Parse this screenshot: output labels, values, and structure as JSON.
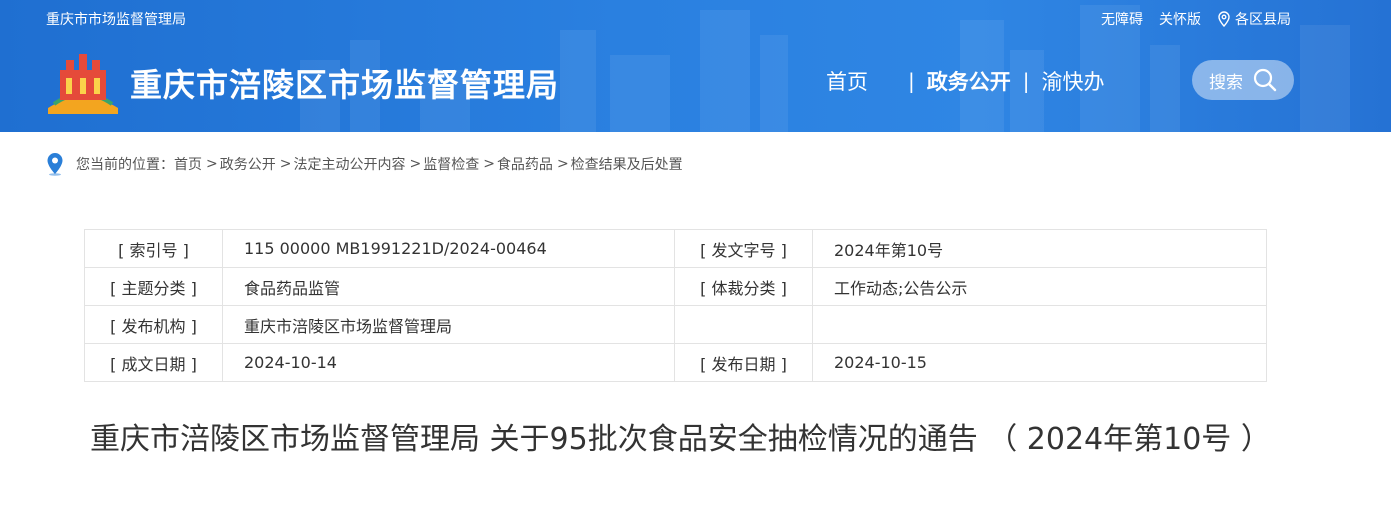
{
  "header": {
    "site_name_small": "重庆市市场监督管理局",
    "title": "重庆市涪陵区市场监督管理局",
    "top_links": {
      "accessibility": "无障碍",
      "care_mode": "关怀版",
      "districts": "各区县局"
    },
    "nav": {
      "home": "首页",
      "separator": "|",
      "gov_affairs": "政务公开",
      "yukuaiban": "渝快办"
    },
    "search_label": "搜索"
  },
  "breadcrumb": {
    "prefix": "您当前的位置：",
    "items": [
      "首页",
      "政务公开",
      "法定主动公开内容",
      "监督检查",
      "食品药品",
      "检查结果及后处置"
    ],
    "arrow": ">"
  },
  "info_table": {
    "rows": [
      {
        "label1": "[ 索引号 ]",
        "value1": "115 00000 MB1991221D/2024-00464",
        "label2": "[ 发文字号 ]",
        "value2": "2024年第10号"
      },
      {
        "label1": "[ 主题分类 ]",
        "value1": "食品药品监管",
        "label2": "[ 体裁分类 ]",
        "value2": "工作动态;公告公示"
      },
      {
        "label1": "[ 发布机构 ]",
        "value1": "重庆市涪陵区市场监督管理局",
        "label2": "",
        "value2": ""
      },
      {
        "label1": "[ 成文日期 ]",
        "value1": "2024-10-14",
        "label2": "[ 发布日期 ]",
        "value2": "2024-10-15"
      }
    ]
  },
  "article": {
    "title": "重庆市涪陵区市场监督管理局 关于95批次食品安全抽检情况的通告 （ 2024年第10号 ）"
  },
  "colors": {
    "header_blue": "#2a80e0",
    "white": "#ffffff",
    "text": "#333333",
    "border": "#e3e3e3"
  },
  "icons": [
    "logo-emblem",
    "location-pin-icon",
    "search-icon"
  ]
}
